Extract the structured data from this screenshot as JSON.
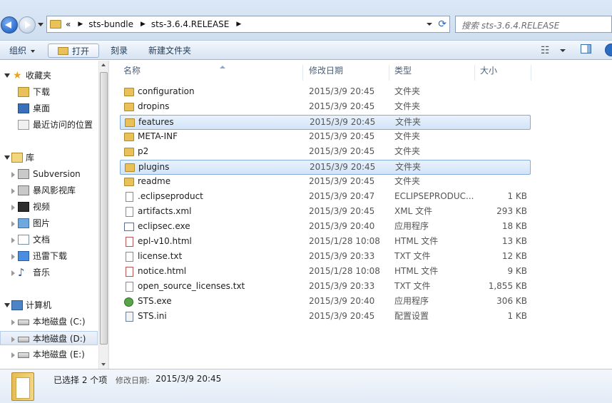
{
  "address": {
    "overflow": "«",
    "segments": [
      "sts-bundle",
      "sts-3.6.4.RELEASE"
    ]
  },
  "search": {
    "placeholder": "搜索 sts-3.6.4.RELEASE"
  },
  "toolbar": {
    "organize": "组织",
    "open": "打开",
    "burn": "刻录",
    "new_folder": "新建文件夹"
  },
  "nav": {
    "favorites": "收藏夹",
    "downloads": "下载",
    "desktop": "桌面",
    "recent": "最近访问的位置",
    "libraries": "库",
    "subversion": "Subversion",
    "storm_video": "暴风影视库",
    "videos": "视频",
    "pictures": "图片",
    "documents": "文档",
    "thunder": "迅雷下载",
    "music": "音乐",
    "computer": "计算机",
    "drive_c": "本地磁盘 (C:)",
    "drive_d": "本地磁盘 (D:)",
    "drive_e": "本地磁盘 (E:)"
  },
  "columns": {
    "name": "名称",
    "date": "修改日期",
    "type": "类型",
    "size": "大小"
  },
  "files": [
    {
      "name": "configuration",
      "date": "2015/3/9 20:45",
      "type": "文件夹",
      "size": "",
      "icon": "folder",
      "selected": false
    },
    {
      "name": "dropins",
      "date": "2015/3/9 20:45",
      "type": "文件夹",
      "size": "",
      "icon": "folder",
      "selected": false
    },
    {
      "name": "features",
      "date": "2015/3/9 20:45",
      "type": "文件夹",
      "size": "",
      "icon": "folder",
      "selected": true
    },
    {
      "name": "META-INF",
      "date": "2015/3/9 20:45",
      "type": "文件夹",
      "size": "",
      "icon": "folder",
      "selected": false
    },
    {
      "name": "p2",
      "date": "2015/3/9 20:45",
      "type": "文件夹",
      "size": "",
      "icon": "folder",
      "selected": false
    },
    {
      "name": "plugins",
      "date": "2015/3/9 20:45",
      "type": "文件夹",
      "size": "",
      "icon": "folder",
      "selected": true
    },
    {
      "name": "readme",
      "date": "2015/3/9 20:45",
      "type": "文件夹",
      "size": "",
      "icon": "folder",
      "selected": false
    },
    {
      "name": ".eclipseproduct",
      "date": "2015/3/9 20:47",
      "type": "ECLIPSEPRODUC...",
      "size": "1 KB",
      "icon": "file",
      "selected": false
    },
    {
      "name": "artifacts.xml",
      "date": "2015/3/9 20:45",
      "type": "XML 文件",
      "size": "293 KB",
      "icon": "file",
      "selected": false
    },
    {
      "name": "eclipsec.exe",
      "date": "2015/3/9 20:40",
      "type": "应用程序",
      "size": "18 KB",
      "icon": "exe",
      "selected": false
    },
    {
      "name": "epl-v10.html",
      "date": "2015/1/28 10:08",
      "type": "HTML 文件",
      "size": "13 KB",
      "icon": "html",
      "selected": false
    },
    {
      "name": "license.txt",
      "date": "2015/3/9 20:33",
      "type": "TXT 文件",
      "size": "12 KB",
      "icon": "file",
      "selected": false
    },
    {
      "name": "notice.html",
      "date": "2015/1/28 10:08",
      "type": "HTML 文件",
      "size": "9 KB",
      "icon": "html",
      "selected": false
    },
    {
      "name": "open_source_licenses.txt",
      "date": "2015/3/9 20:33",
      "type": "TXT 文件",
      "size": "1,855 KB",
      "icon": "file",
      "selected": false
    },
    {
      "name": "STS.exe",
      "date": "2015/3/9 20:40",
      "type": "应用程序",
      "size": "306 KB",
      "icon": "sts",
      "selected": false
    },
    {
      "name": "STS.ini",
      "date": "2015/3/9 20:45",
      "type": "配置设置",
      "size": "1 KB",
      "icon": "ini",
      "selected": false
    }
  ],
  "details": {
    "selection": "已选择 2 个项",
    "modified_label": "修改日期:",
    "modified_value": "2015/3/9 20:45"
  }
}
